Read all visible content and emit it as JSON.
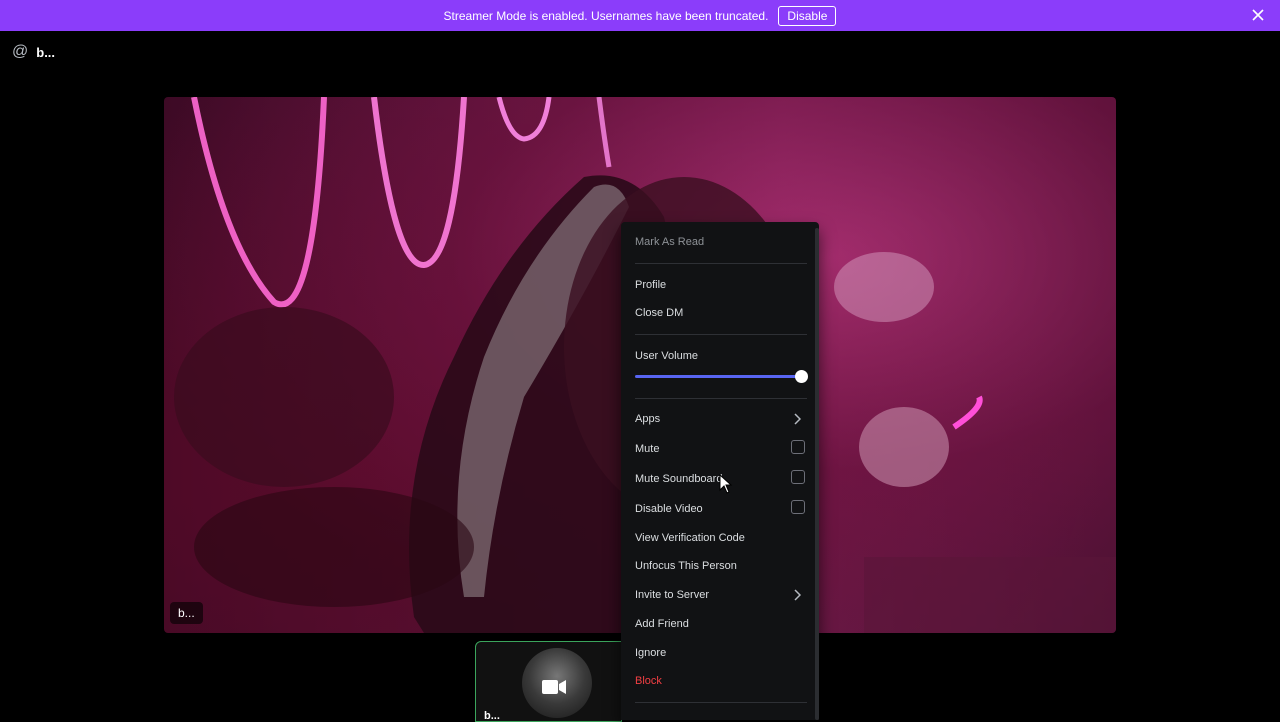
{
  "banner": {
    "text": "Streamer Mode is enabled. Usernames have been truncated.",
    "button_label": "Disable",
    "icon": "close-icon"
  },
  "header": {
    "at_icon": "@",
    "username": "b..."
  },
  "video": {
    "tile_label": "b...",
    "mini_tile_label": "b...",
    "mini_icon": "video-camera-icon"
  },
  "context_menu": {
    "items": {
      "mark_as_read": "Mark As Read",
      "profile": "Profile",
      "close_dm": "Close DM",
      "user_volume": "User Volume",
      "apps": "Apps",
      "mute": "Mute",
      "mute_soundboard": "Mute Soundboard",
      "disable_video": "Disable Video",
      "view_verification_code": "View Verification Code",
      "unfocus": "Unfocus This Person",
      "invite_to_server": "Invite to Server",
      "add_friend": "Add Friend",
      "ignore": "Ignore",
      "block": "Block"
    },
    "user_volume_value": 1.0,
    "checkbox_states": {
      "mute": false,
      "mute_soundboard": false,
      "disable_video": false
    }
  },
  "colors": {
    "banner": "#8b3dfa",
    "slider_fill": "#5865f2",
    "danger": "#f23f43",
    "speaking_border": "#3ba55c"
  }
}
